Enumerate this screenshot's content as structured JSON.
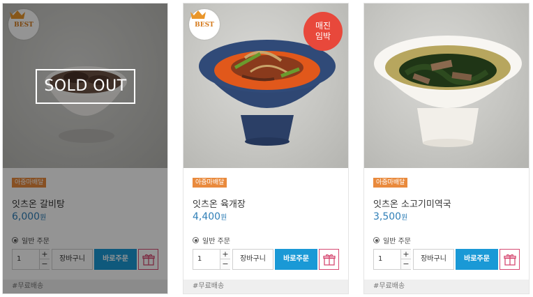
{
  "products": [
    {
      "best_label": "BEST",
      "tag": "아줌마배달",
      "name": "잇츠온 갈비탕",
      "price": "6,000",
      "currency": "원",
      "order_type": "일반 주문",
      "qty": "1",
      "plus": "+",
      "minus": "−",
      "cart_label": "장바구니",
      "buy_label": "바로주문",
      "shipping": "#무료배송",
      "soldout_label": "SOLD OUT",
      "icon": "gift-icon"
    },
    {
      "best_label": "BEST",
      "soon_label": "매진\n임박",
      "tag": "아줌마배달",
      "name": "잇츠온 육개장",
      "price": "4,400",
      "currency": "원",
      "order_type": "일반 주문",
      "qty": "1",
      "plus": "+",
      "minus": "−",
      "cart_label": "장바구니",
      "buy_label": "바로주문",
      "shipping": "#무료배송",
      "icon": "gift-icon"
    },
    {
      "tag": "아줌마배달",
      "name": "잇츠온 소고기미역국",
      "price": "3,500",
      "currency": "원",
      "order_type": "일반 주문",
      "qty": "1",
      "plus": "+",
      "minus": "−",
      "cart_label": "장바구니",
      "buy_label": "바로주문",
      "shipping": "#무료배송",
      "icon": "gift-icon"
    }
  ],
  "colors": {
    "tag": "#e98a3d",
    "price": "#2f7fb7",
    "buy_button": "#1a99d6",
    "gift_border": "#d64a72",
    "soon_badge": "#e8483b"
  }
}
